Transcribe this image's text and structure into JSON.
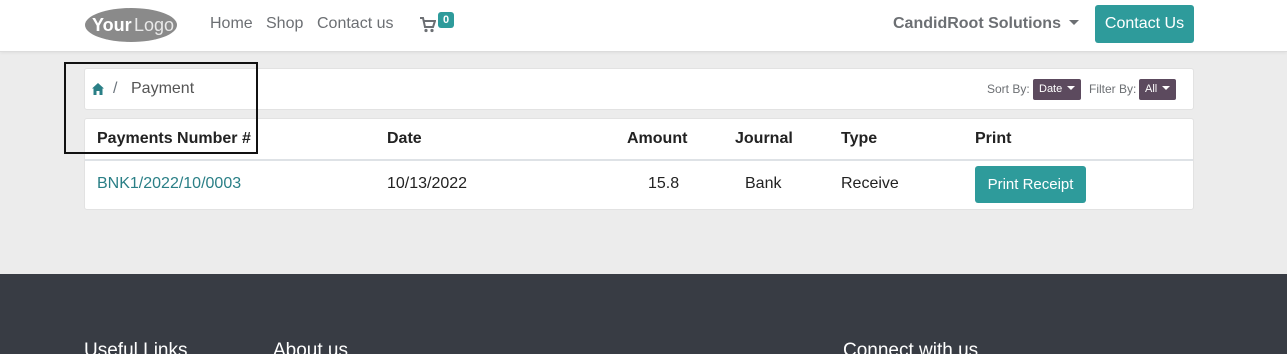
{
  "header": {
    "logo_text": "YourLogo",
    "nav": [
      "Home",
      "Shop",
      "Contact us"
    ],
    "cart_count": "0",
    "company": "CandidRoot Solutions",
    "contact_button": "Contact Us",
    "accent_color": "#2e9b9b"
  },
  "breadcrumb": {
    "home_icon": "home-icon",
    "separator": "/",
    "current": "Payment"
  },
  "controls": {
    "sort_label": "Sort By:",
    "sort_value": "Date",
    "filter_label": "Filter By:",
    "filter_value": "All",
    "button_color": "#5c4a5e"
  },
  "table": {
    "headers": [
      "Payments Number #",
      "Date",
      "Amount",
      "Journal",
      "Type",
      "Print"
    ],
    "rows": [
      {
        "number": "BNK1/2022/10/0003",
        "date": "10/13/2022",
        "amount": "15.8",
        "journal": "Bank",
        "type": "Receive",
        "print_label": "Print Receipt"
      }
    ]
  },
  "footer": {
    "headings": [
      "Useful Links",
      "About us",
      "Connect with us"
    ]
  }
}
